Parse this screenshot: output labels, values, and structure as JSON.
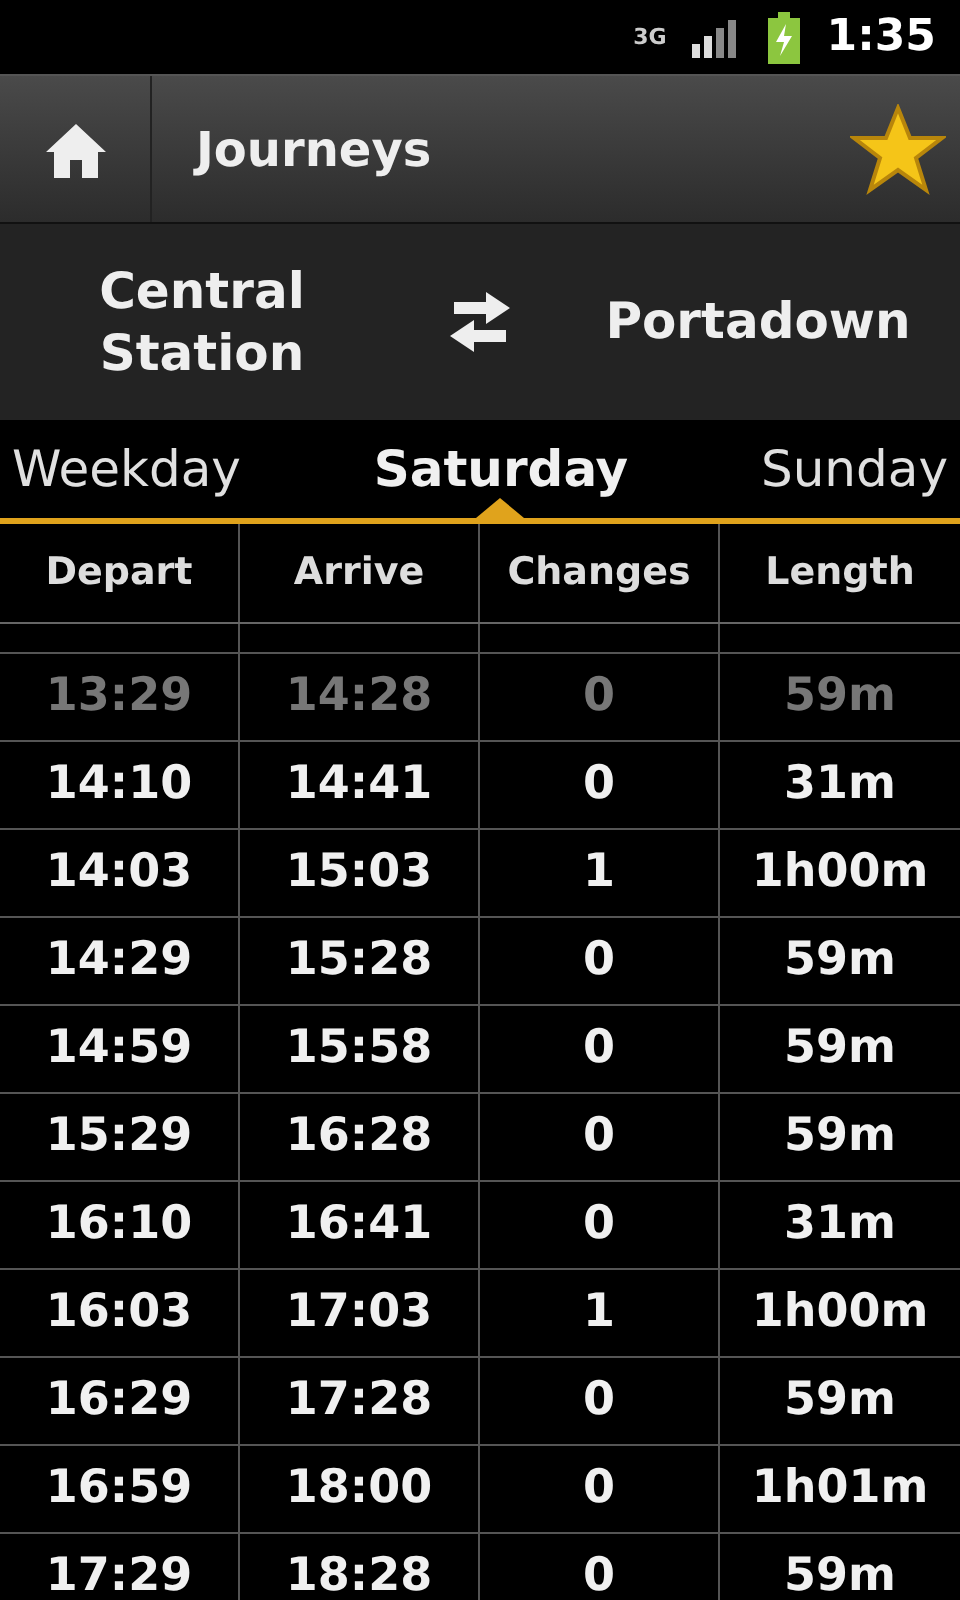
{
  "status_bar": {
    "time": "1:35",
    "network": "3G"
  },
  "header": {
    "title": "Journeys",
    "favorite": true
  },
  "route": {
    "from": "Central Station",
    "to": "Portadown"
  },
  "tabs": [
    {
      "label": "Weekday",
      "selected": false
    },
    {
      "label": "Saturday",
      "selected": true
    },
    {
      "label": "Sunday",
      "selected": false
    }
  ],
  "table": {
    "columns": [
      "Depart",
      "Arrive",
      "Changes",
      "Length"
    ],
    "rows": [
      {
        "cells": [
          "13:29",
          "14:28",
          "0",
          "59m"
        ],
        "past": true
      },
      {
        "cells": [
          "14:10",
          "14:41",
          "0",
          "31m"
        ],
        "past": false
      },
      {
        "cells": [
          "14:03",
          "15:03",
          "1",
          "1h00m"
        ],
        "past": false
      },
      {
        "cells": [
          "14:29",
          "15:28",
          "0",
          "59m"
        ],
        "past": false
      },
      {
        "cells": [
          "14:59",
          "15:58",
          "0",
          "59m"
        ],
        "past": false
      },
      {
        "cells": [
          "15:29",
          "16:28",
          "0",
          "59m"
        ],
        "past": false
      },
      {
        "cells": [
          "16:10",
          "16:41",
          "0",
          "31m"
        ],
        "past": false
      },
      {
        "cells": [
          "16:03",
          "17:03",
          "1",
          "1h00m"
        ],
        "past": false
      },
      {
        "cells": [
          "16:29",
          "17:28",
          "0",
          "59m"
        ],
        "past": false
      },
      {
        "cells": [
          "16:59",
          "18:00",
          "0",
          "1h01m"
        ],
        "past": false
      },
      {
        "cells": [
          "17:29",
          "18:28",
          "0",
          "59m"
        ],
        "past": false
      }
    ]
  }
}
